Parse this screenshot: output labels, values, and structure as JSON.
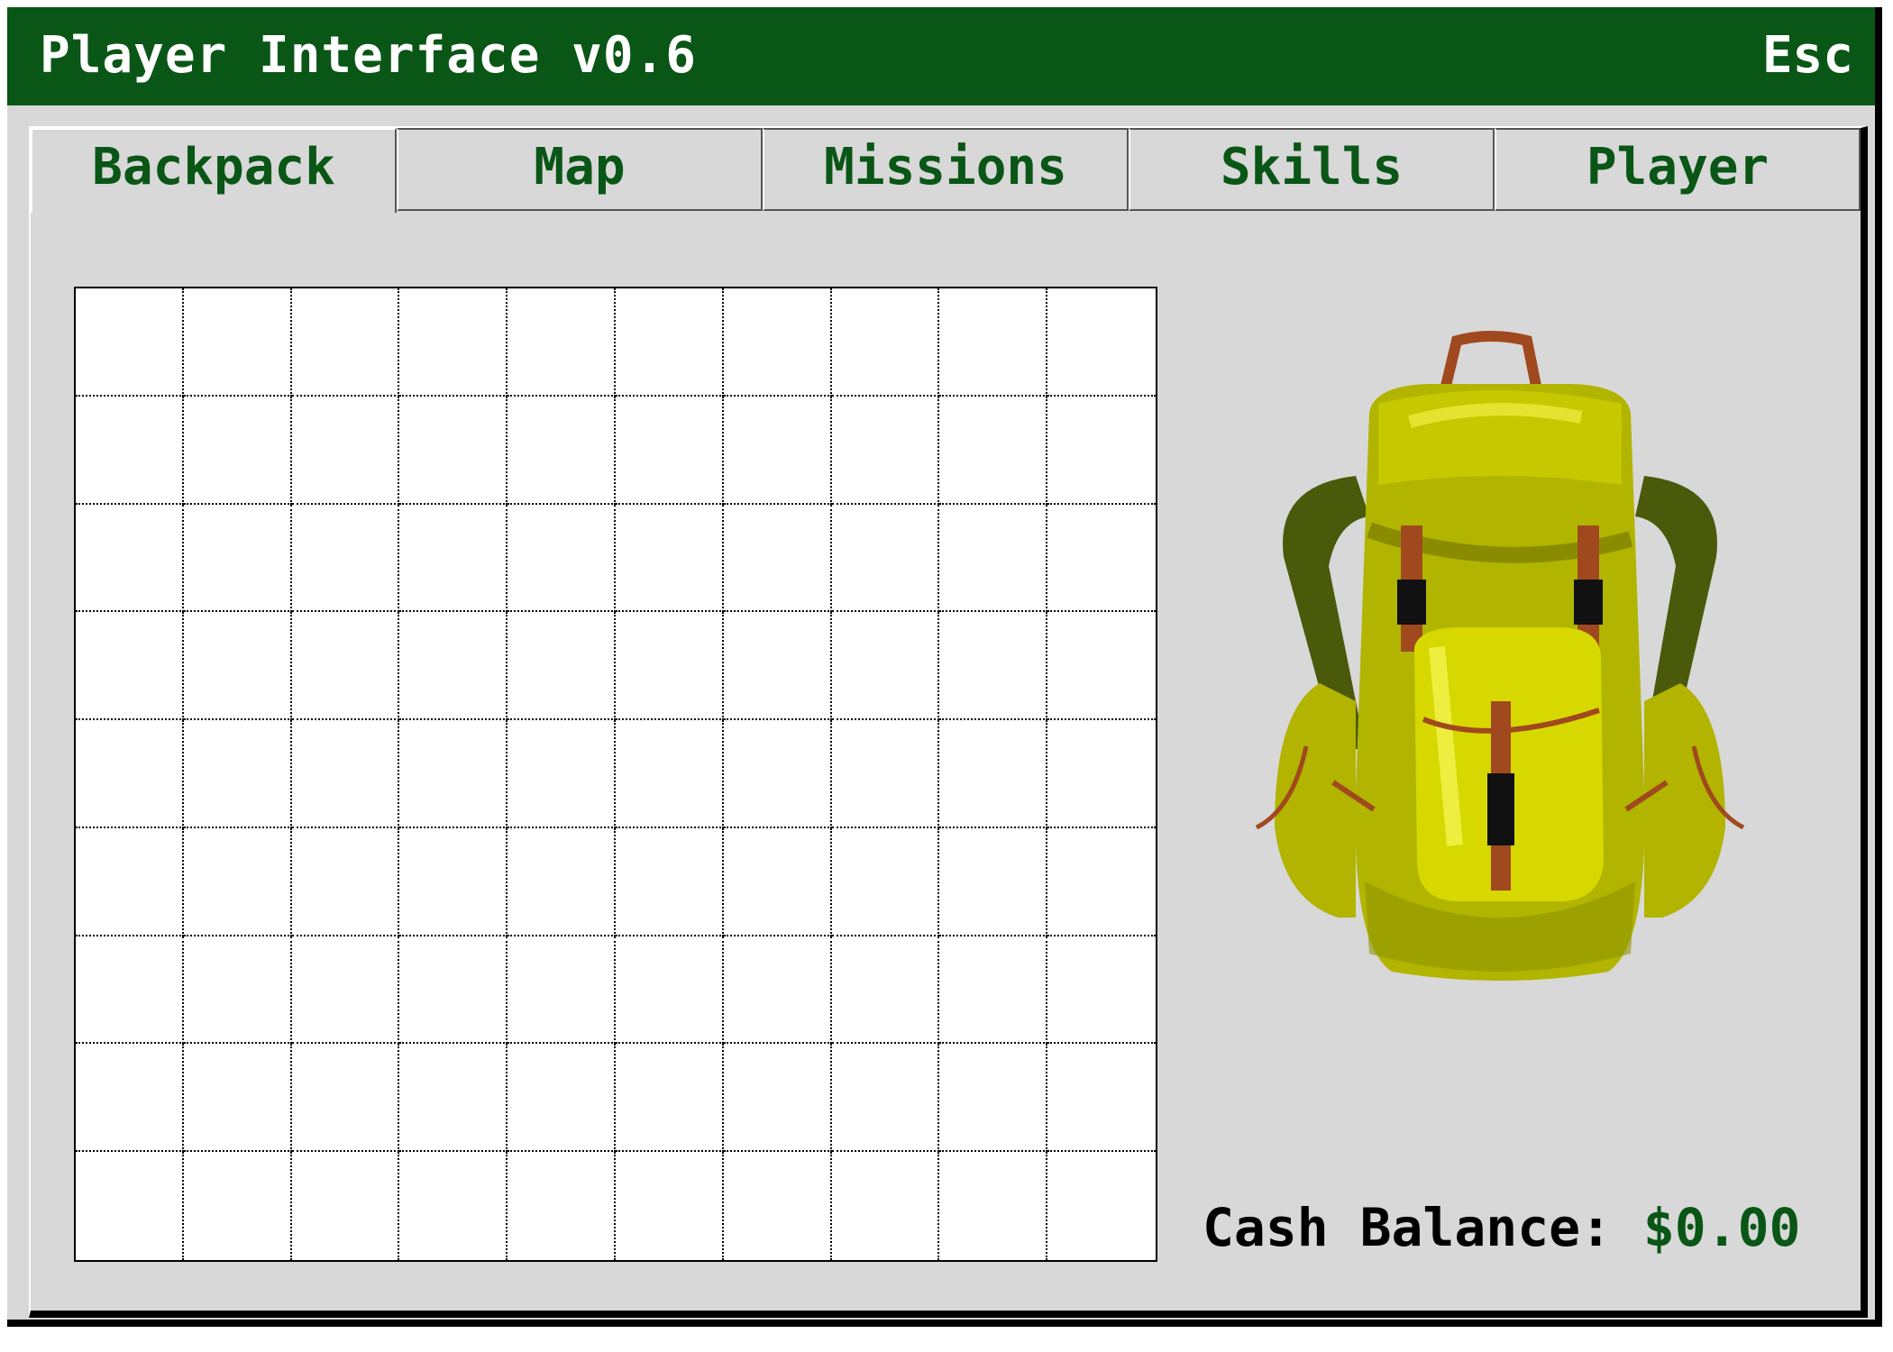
{
  "window": {
    "title": "Player Interface v0.6",
    "close_label": "Esc"
  },
  "tabs": [
    {
      "label": "Backpack",
      "active": true
    },
    {
      "label": "Map",
      "active": false
    },
    {
      "label": "Missions",
      "active": false
    },
    {
      "label": "Skills",
      "active": false
    },
    {
      "label": "Player",
      "active": false
    }
  ],
  "inventory": {
    "columns": 10,
    "rows": 9,
    "items": []
  },
  "cash": {
    "label": "Cash Balance:",
    "value": "$0.00"
  },
  "colors": {
    "title_bar": "#0a5616",
    "accent_text": "#0a5616",
    "panel_bg": "#d8d8d8",
    "grid_bg": "#ffffff"
  },
  "icons": {
    "backpack": "backpack-icon"
  }
}
